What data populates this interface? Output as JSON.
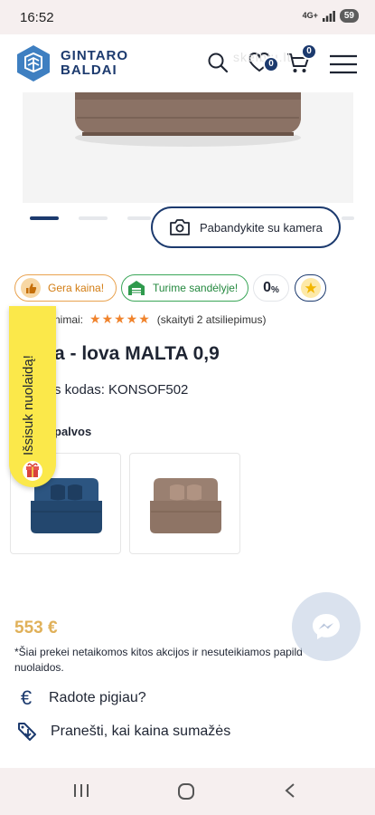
{
  "status_bar": {
    "time": "16:52",
    "network": "4G+",
    "battery": "59"
  },
  "header": {
    "brand_line1": "GINTARO",
    "brand_line2": "BALDAI",
    "wishlist_count": "0",
    "cart_count": "0",
    "watermark": "skelbiu.lt"
  },
  "gallery": {
    "dots_total": 4,
    "active_dot": 1,
    "camera_button": "Pabandykite su kamera"
  },
  "tags": {
    "price_tag": "Gera kaina!",
    "stock_tag": "Turime sandėlyje!",
    "zero_tag": "0",
    "zero_tag_unit": "%"
  },
  "product": {
    "rating_prefix": "nimai:",
    "rating_stars": 5,
    "rating_text": "(skaityti 2 atsiliepimus)",
    "title": "a - lova MALTA 0,9",
    "sku": "s kodas: KONSOF502",
    "colors_label": "palvos",
    "swatches": [
      {
        "color": "#23476e"
      },
      {
        "color": "#8e7465"
      }
    ]
  },
  "discount_tab": {
    "label": "Išsisuk nuolaidą!"
  },
  "pricing": {
    "price": "553 €",
    "note": "*Šiai prekei netaikomos kitos akcijos ir nesuteikiamos papild nuolaidos.",
    "cheaper_link": "Radote pigiau?",
    "notify_link": "Pranešti, kai kaina sumažės"
  },
  "colors": {
    "brand_navy": "#1c3a6e",
    "price_gold": "#e0b15a",
    "tab_yellow": "#fbe84a",
    "stock_green": "#3aa658",
    "price_orange": "#e9a24f",
    "star_orange": "#f0832c"
  }
}
